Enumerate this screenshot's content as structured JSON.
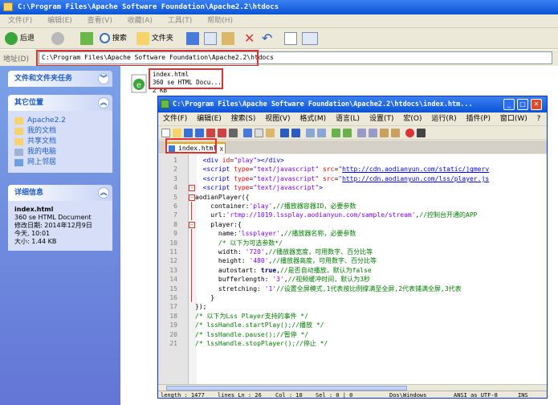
{
  "explorer": {
    "title": "C:\\Program Files\\Apache Software Foundation\\Apache2.2\\htdocs",
    "menu": [
      "文件(F)",
      "编辑(E)",
      "查看(V)",
      "收藏(A)",
      "工具(T)",
      "帮助(H)"
    ],
    "toolbar": {
      "back": "后退",
      "search": "搜索",
      "folders": "文件夹"
    },
    "address_label": "地址(D)",
    "address_value": "C:\\Program Files\\Apache Software Foundation\\Apache2.2\\htdocs",
    "tasks_header": "文件和文件夹任务",
    "places_header": "其它位置",
    "places": [
      "Apache2.2",
      "我的文档",
      "共享文档",
      "我的电脑",
      "网上邻居"
    ],
    "details_header": "详细信息",
    "details": {
      "name": "index.html",
      "type": "360 se HTML Document",
      "modified_label": "修改日期: 2014年12月9日",
      "modified_day": "今天, 10:01",
      "size": "大小: 1.44 KB"
    },
    "file": {
      "name": "index.html",
      "type": "360 se HTML Docu...",
      "size": "2 KB"
    }
  },
  "notepad": {
    "title": "C:\\Program Files\\Apache Software Foundation\\Apache2.2\\htdocs\\index.htm...",
    "menu": [
      "文件(F)",
      "编辑(E)",
      "搜索(S)",
      "视图(V)",
      "格式(M)",
      "语言(L)",
      "设置(T)",
      "宏(O)",
      "运行(R)",
      "插件(P)",
      "窗口(W)",
      "?"
    ],
    "tab": "index.html",
    "tab_close": "X",
    "line_numbers": [
      "1",
      "2",
      "3",
      "4",
      "5",
      "6",
      "7",
      "8",
      "9",
      "10",
      "11",
      "12",
      "13",
      "14",
      "15",
      "16",
      "17",
      "18",
      "19",
      "20",
      "21"
    ],
    "status": {
      "length": "length : 1477",
      "lines": "lines Ln : 26",
      "col": "Col : 10",
      "sel": "Sel : 0 | 0",
      "eol": "Dos\\Windows",
      "enc": "ANSI as UTF-8",
      "ins": "INS"
    }
  },
  "colors": {
    "title_blue": "#0a53d6",
    "highlight_red": "#e53030",
    "panel_bg": "#d6dff7"
  }
}
